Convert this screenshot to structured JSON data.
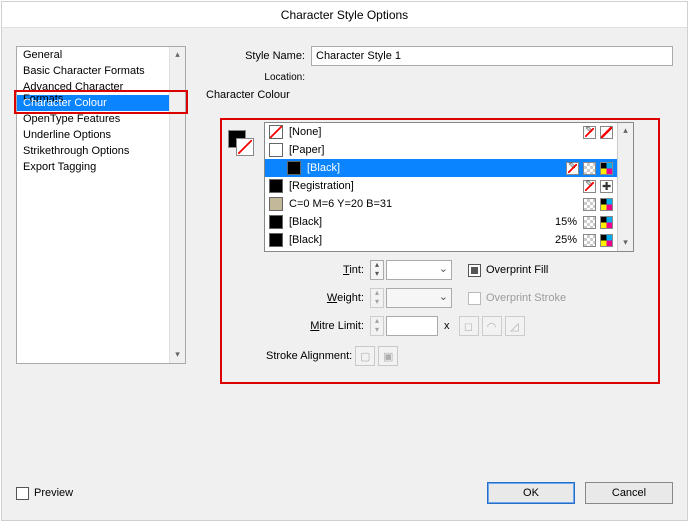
{
  "title": "Character Style Options",
  "styleName": {
    "label": "Style Name:",
    "value": "Character Style 1"
  },
  "location": {
    "label": "Location:"
  },
  "sectionTitle": "Character Colour",
  "categories": [
    {
      "label": "General"
    },
    {
      "label": "Basic Character Formats"
    },
    {
      "label": "Advanced Character Formats"
    },
    {
      "label": "Character Colour",
      "selected": true
    },
    {
      "label": "OpenType Features"
    },
    {
      "label": "Underline Options"
    },
    {
      "label": "Strikethrough Options"
    },
    {
      "label": "Export Tagging"
    }
  ],
  "swatches": [
    {
      "name": "[None]",
      "color": "none",
      "icons": [
        "pencil-slash",
        "red-slash"
      ]
    },
    {
      "name": "[Paper]",
      "color": "#ffffff",
      "icons": []
    },
    {
      "name": "[Black]",
      "color": "#000000",
      "indent": true,
      "selected": true,
      "icons": [
        "pencil-slash",
        "grey",
        "cmyk"
      ]
    },
    {
      "name": "[Registration]",
      "color": "#000000",
      "icons": [
        "pencil-slash",
        "reg"
      ]
    },
    {
      "name": "C=0 M=6 Y=20 B=31",
      "color": "#c4b89a",
      "icons": [
        "grey",
        "cmyk"
      ]
    },
    {
      "name": "[Black]",
      "color": "#000000",
      "pct": "15%",
      "icons": [
        "grey",
        "cmyk"
      ]
    },
    {
      "name": "[Black]",
      "color": "#000000",
      "pct": "25%",
      "icons": [
        "grey",
        "cmyk"
      ]
    }
  ],
  "tint": {
    "label": "Tint:"
  },
  "weight": {
    "label": "Weight:"
  },
  "mitre": {
    "label": "Mitre Limit:",
    "x": "x"
  },
  "overprintFill": {
    "label": "Overprint Fill"
  },
  "overprintStroke": {
    "label": "Overprint Stroke"
  },
  "strokeAlign": {
    "label": "Stroke Alignment:"
  },
  "preview": {
    "label": "Preview"
  },
  "buttons": {
    "ok": "OK",
    "cancel": "Cancel"
  }
}
